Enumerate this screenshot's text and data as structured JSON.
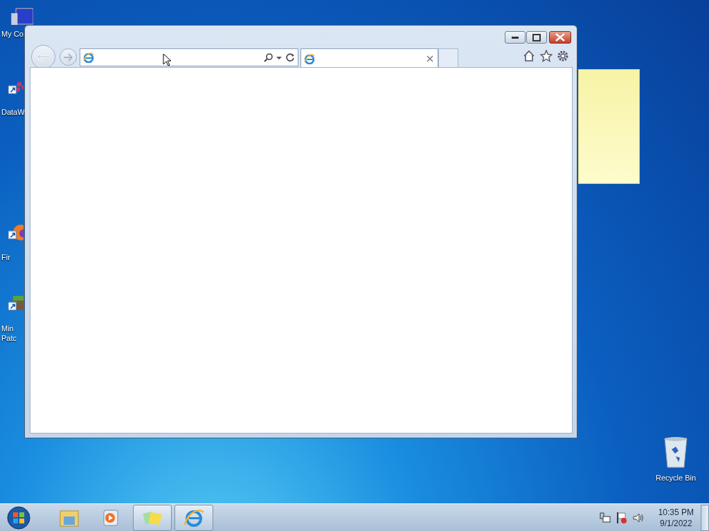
{
  "desktop_icons": [
    {
      "kind": "computer",
      "lines": [
        "My Co"
      ]
    },
    {
      "kind": "shortcut-dots",
      "lines": [
        "DataW"
      ]
    },
    {
      "kind": "shortcut-fox",
      "lines": [
        "Fir"
      ]
    },
    {
      "kind": "shortcut-block",
      "lines": [
        "Min",
        "Patc"
      ]
    }
  ],
  "recycle_bin": {
    "label": "Recycle Bin"
  },
  "browser": {
    "tabs": [
      {
        "selected": true
      }
    ]
  },
  "taskbar": {
    "items": [
      {
        "kind": "explorer",
        "running": false
      },
      {
        "kind": "media",
        "running": false
      },
      {
        "kind": "sticky",
        "running": true
      },
      {
        "kind": "ie",
        "running": true
      }
    ],
    "clock": {
      "time": "10:35 PM",
      "date": "9/1/2022"
    }
  }
}
